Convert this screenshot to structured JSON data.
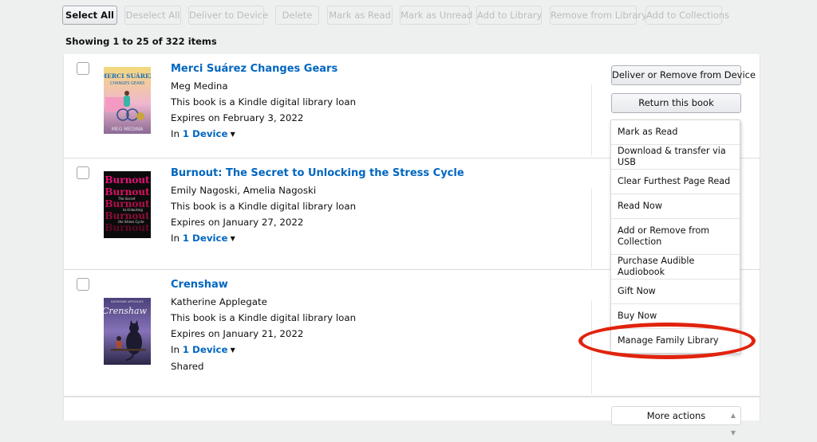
{
  "toolbar": {
    "buttons": [
      {
        "label": "Select All",
        "enabled": true
      },
      {
        "label": "Deselect All",
        "enabled": false
      },
      {
        "label": "Deliver to Device",
        "enabled": false
      },
      {
        "label": "Delete",
        "enabled": false
      },
      {
        "label": "Mark as Read",
        "enabled": false
      },
      {
        "label": "Mark as Unread",
        "enabled": false
      },
      {
        "label": "Add to Library",
        "enabled": false
      },
      {
        "label": "Remove from Library",
        "enabled": false
      },
      {
        "label": "Add to Collections",
        "enabled": false
      }
    ]
  },
  "showing_text": "Showing 1 to 25 of 322 items",
  "books": [
    {
      "title": "Merci Suárez Changes Gears",
      "author": "Meg Medina",
      "loan_text": "This book is a Kindle digital library loan",
      "expires": "Expires on February 3, 2022",
      "in_label": "In",
      "device_link": "1 Device",
      "shared": "",
      "cover": {
        "top_text": "MERCI SUÁREZ",
        "sub_text": "CHANGES GEARS",
        "bottom_text": "MEG MEDINA",
        "colors": [
          "#f2d77a",
          "#e89bc0",
          "#7a5a8a"
        ]
      }
    },
    {
      "title": "Burnout: The Secret to Unlocking the Stress Cycle",
      "author": "Emily Nagoski, Amelia Nagoski",
      "loan_text": "This book is a Kindle digital library loan",
      "expires": "Expires on January 27, 2022",
      "in_label": "In",
      "device_link": "1 Device",
      "shared": "",
      "cover": {
        "top_text": "Burnout",
        "colors": [
          "#0a0a0a",
          "#e0116b",
          "#8a0d35"
        ]
      }
    },
    {
      "title": "Crenshaw",
      "author": "Katherine Applegate",
      "loan_text": "This book is a Kindle digital library loan",
      "expires": "Expires on January 21, 2022",
      "in_label": "In",
      "device_link": "1 Device",
      "shared": "Shared",
      "cover": {
        "top_text": "Crenshaw",
        "colors": [
          "#3d3a6b",
          "#7a6bb0",
          "#1c1a30"
        ]
      }
    }
  ],
  "actions": {
    "deliver_remove": "Deliver or Remove from Device",
    "return_book": "Return this book",
    "more_actions": "More actions"
  },
  "menu": {
    "items": [
      "Mark as Read",
      "Download & transfer via USB",
      "Clear Furthest Page Read",
      "Read Now",
      "Add or Remove from Collection",
      "Purchase Audible Audiobook",
      "Gift Now",
      "Buy Now",
      "Manage Family Library"
    ],
    "highlighted": "Manage Family Library"
  },
  "annotation": {
    "color": "#e1230e",
    "target": "Manage Family Library"
  }
}
